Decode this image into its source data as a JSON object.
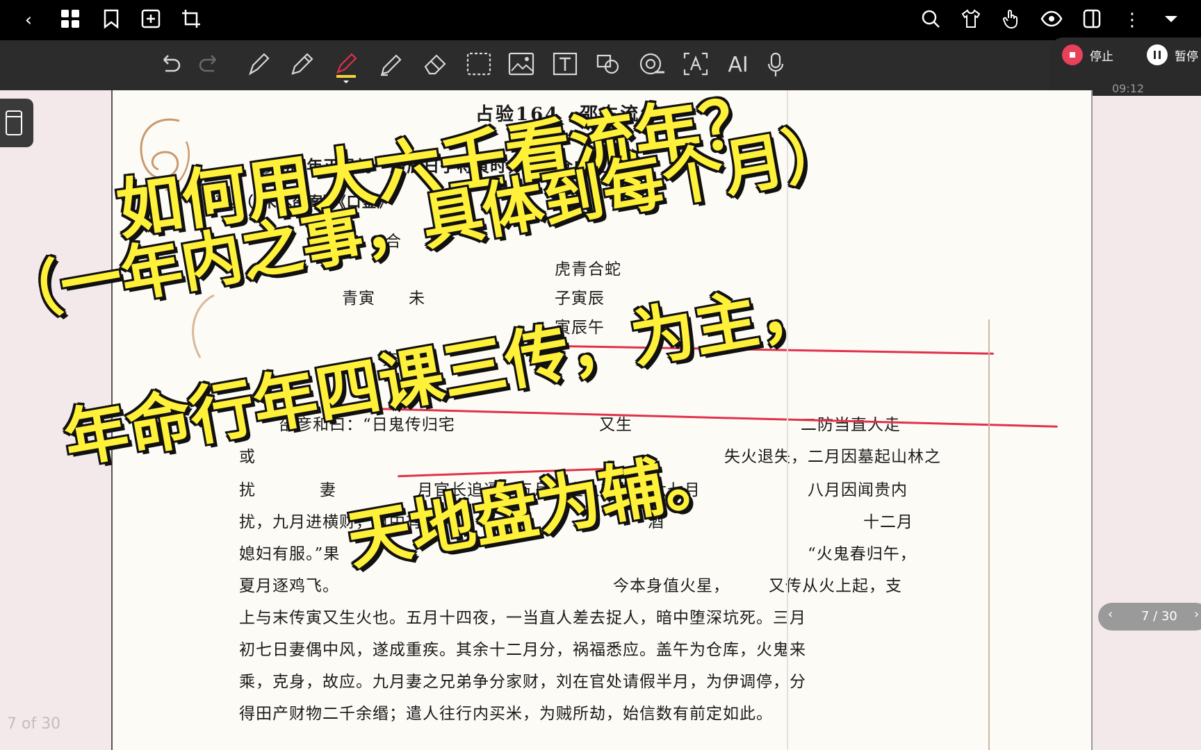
{
  "topbar": {
    "icons": [
      "back-icon",
      "grid-icon",
      "bookmark-icon",
      "add-page-icon",
      "crop-icon",
      "search-icon",
      "shirt-icon",
      "touch-icon",
      "eye-icon",
      "panel-icon",
      "more-icon",
      "collapse-icon"
    ]
  },
  "toolbar": {
    "ai_label": "AI",
    "pen_colors": [
      "#ffffff",
      "#3e5aa8",
      "#e02d3c",
      "#cfcfcf"
    ]
  },
  "recorder": {
    "stop_label": "停止",
    "pause_label": "暂停",
    "time": "09:12"
  },
  "document": {
    "header": "占验164　邵占流年",
    "lines": [
      "○己酉年正月初一庚辰日子将寅时，刘监仓虎生三",
      "事。（《宋本邵案》《口鉴》",
      "合",
      "虎青合蛇",
      "青寅　　未",
      "子寅辰",
      "寅辰午",
      "亥戌",
      "阴",
      "邵彦和曰：“日鬼传归宅",
      "又生",
      "二防当直人走",
      "或",
      "失火退失，二月因墓起山林之",
      "扰",
      "妻",
      "月官长追逼，五月当直人有失，六七月",
      "八月因闻贵内",
      "扰，九月进横财，财中有失，",
      "酒",
      "十二月",
      "媳妇有服。”果",
      "“火鬼春归午，",
      "夏月逐鸡飞。",
      "今本身值火星，",
      "又传从火上起，支",
      "上与末传寅又生火也。五月十四夜，一当直人差去捉人，暗中堕深坑死。三月",
      "初七日妻偶中风，遂成重疾。其余十二月分，祸福悉应。盖午为仓库，火鬼来",
      "乘，克身，故应。九月妻之兄弟争分家财，刘在官处请假半月，为伊调停，分",
      "得田产财物二千余缗；遣人往行内买米，为贼所劫，始信数有前定如此。"
    ],
    "footnote_mark": "①"
  },
  "overlay": {
    "line1": "如何用大六壬看流年？",
    "line2": "（一年内之事，具体到每个月）",
    "line3": "年命行年四课三传，为主，",
    "line4": "天地盘为辅。"
  },
  "pager": {
    "label": "7 / 30",
    "page_of": "7 of 30"
  }
}
